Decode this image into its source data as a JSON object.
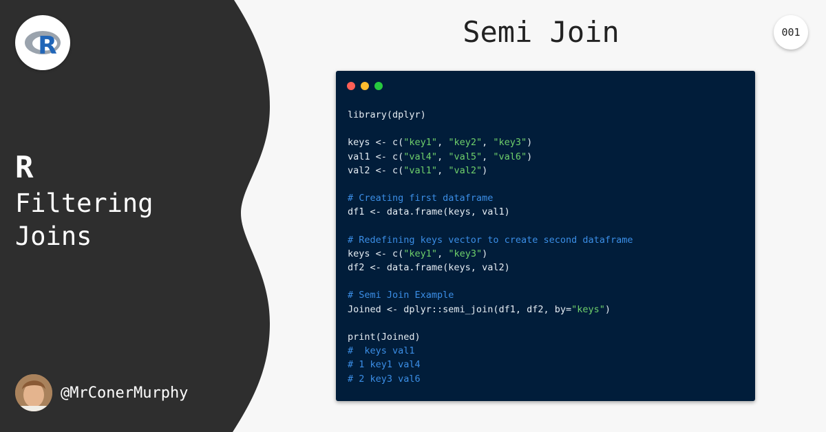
{
  "sidebar": {
    "logo": {
      "icon": "r-language-logo-icon",
      "letter": "R"
    },
    "title_big": "R",
    "title_line1": "Filtering",
    "title_line2": "Joins",
    "author_handle": "@MrConerMurphy",
    "colors": {
      "panel": "#2e2e2e",
      "text": "#ffffff"
    }
  },
  "header": {
    "title": "Semi Join",
    "page_number": "001"
  },
  "code_window": {
    "colors": {
      "background": "#011d3a",
      "dot_red": "#ff5f56",
      "dot_yellow": "#ffbd2e",
      "dot_green": "#27c93f",
      "string": "#6fd06b",
      "comment": "#3b8ee6",
      "text": "#e6edf3"
    },
    "lines": [
      {
        "parts": [
          {
            "t": "library(dplyr)",
            "k": "plain"
          }
        ]
      },
      {
        "parts": []
      },
      {
        "parts": [
          {
            "t": "keys <- c(",
            "k": "plain"
          },
          {
            "t": "\"key1\"",
            "k": "str"
          },
          {
            "t": ", ",
            "k": "plain"
          },
          {
            "t": "\"key2\"",
            "k": "str"
          },
          {
            "t": ", ",
            "k": "plain"
          },
          {
            "t": "\"key3\"",
            "k": "str"
          },
          {
            "t": ")",
            "k": "plain"
          }
        ]
      },
      {
        "parts": [
          {
            "t": "val1 <- c(",
            "k": "plain"
          },
          {
            "t": "\"val4\"",
            "k": "str"
          },
          {
            "t": ", ",
            "k": "plain"
          },
          {
            "t": "\"val5\"",
            "k": "str"
          },
          {
            "t": ", ",
            "k": "plain"
          },
          {
            "t": "\"val6\"",
            "k": "str"
          },
          {
            "t": ")",
            "k": "plain"
          }
        ]
      },
      {
        "parts": [
          {
            "t": "val2 <- c(",
            "k": "plain"
          },
          {
            "t": "\"val1\"",
            "k": "str"
          },
          {
            "t": ", ",
            "k": "plain"
          },
          {
            "t": "\"val2\"",
            "k": "str"
          },
          {
            "t": ")",
            "k": "plain"
          }
        ]
      },
      {
        "parts": []
      },
      {
        "parts": [
          {
            "t": "# Creating first dataframe",
            "k": "cmt"
          }
        ]
      },
      {
        "parts": [
          {
            "t": "df1 <- data.frame(keys, val1)",
            "k": "plain"
          }
        ]
      },
      {
        "parts": []
      },
      {
        "parts": [
          {
            "t": "# Redefining keys vector to create second dataframe",
            "k": "cmt"
          }
        ]
      },
      {
        "parts": [
          {
            "t": "keys <- c(",
            "k": "plain"
          },
          {
            "t": "\"key1\"",
            "k": "str"
          },
          {
            "t": ", ",
            "k": "plain"
          },
          {
            "t": "\"key3\"",
            "k": "str"
          },
          {
            "t": ")",
            "k": "plain"
          }
        ]
      },
      {
        "parts": [
          {
            "t": "df2 <- data.frame(keys, val2)",
            "k": "plain"
          }
        ]
      },
      {
        "parts": []
      },
      {
        "parts": [
          {
            "t": "# Semi Join Example",
            "k": "cmt"
          }
        ]
      },
      {
        "parts": [
          {
            "t": "Joined <- dplyr::semi_join(df1, df2, by=",
            "k": "plain"
          },
          {
            "t": "\"keys\"",
            "k": "str"
          },
          {
            "t": ")",
            "k": "plain"
          }
        ]
      },
      {
        "parts": []
      },
      {
        "parts": [
          {
            "t": "print(Joined)",
            "k": "plain"
          }
        ]
      },
      {
        "parts": [
          {
            "t": "#  keys val1",
            "k": "cmt"
          }
        ]
      },
      {
        "parts": [
          {
            "t": "# 1 key1 val4",
            "k": "cmt"
          }
        ]
      },
      {
        "parts": [
          {
            "t": "# 2 key3 val6",
            "k": "cmt"
          }
        ]
      }
    ]
  }
}
